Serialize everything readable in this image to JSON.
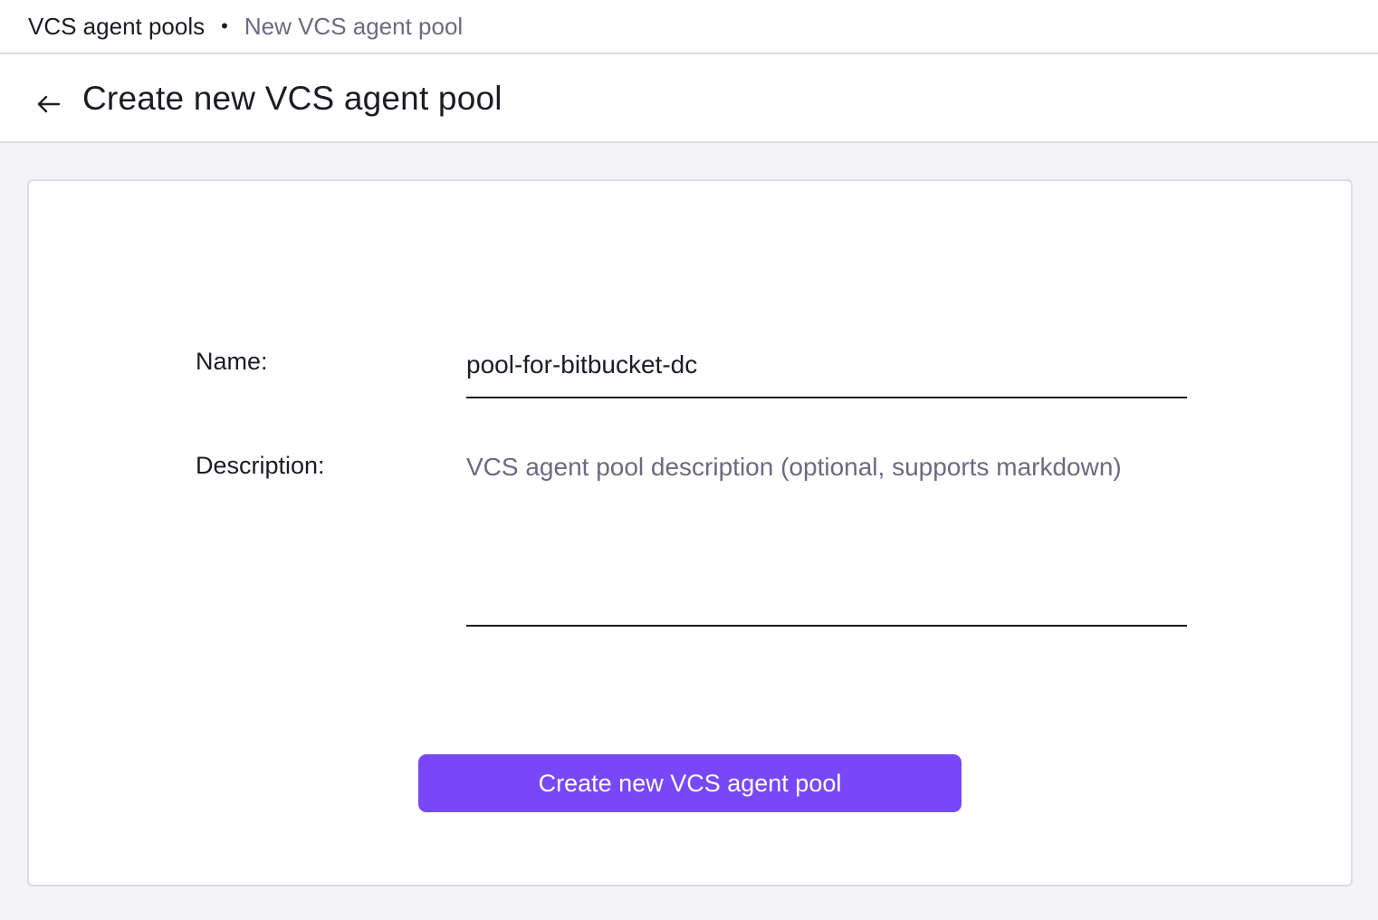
{
  "breadcrumb": {
    "items": [
      {
        "label": "VCS agent pools"
      },
      {
        "label": "New VCS agent pool"
      }
    ],
    "separator": "•"
  },
  "header": {
    "back_icon": "arrow-left-icon",
    "title": "Create new VCS agent pool"
  },
  "form": {
    "name_label": "Name:",
    "name_value": "pool-for-bitbucket-dc",
    "description_label": "Description:",
    "description_value": "",
    "description_placeholder": "VCS agent pool description (optional, supports markdown)",
    "submit_label": "Create new VCS agent pool"
  },
  "colors": {
    "accent": "#7848f8",
    "page_background": "#f3f3f8",
    "muted_text": "#6b6b80"
  }
}
